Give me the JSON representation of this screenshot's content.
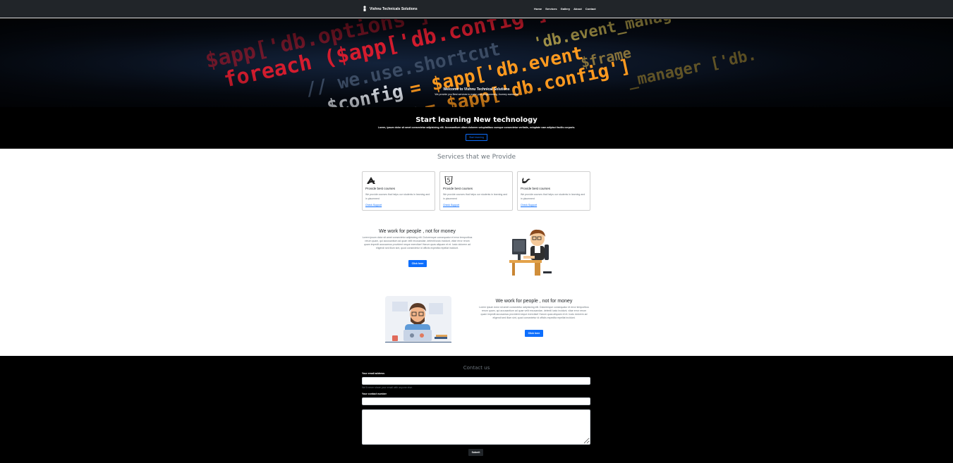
{
  "navbar": {
    "brand": "Vishnu Technicals Solutions",
    "links": [
      "Home",
      "Services",
      "Gallery",
      "About",
      "Contact"
    ]
  },
  "hero": {
    "title": "Welcome to Vishnu Technical Solutions",
    "subtitle": "We provide you Best services to make your programming Journey awesome"
  },
  "learn": {
    "title": "Start learning New technology",
    "text": "Lorem, ipsum dolor sit amet consectetur adipisicing elit. Accusantium ullam dolorem voluptatibus cumque consectetur veritatis, voluptate nam adipisci facilis corporis.",
    "button": "Start learning"
  },
  "services": {
    "title": "Services that we Provide",
    "cards": [
      {
        "icon": "angular-style-icon",
        "title": "Provide best courses",
        "text": "We provide courses that helps our students in learning and in placement",
        "link": "Check Support"
      },
      {
        "icon": "html5-icon",
        "title": "Provide best courses",
        "text": "We provide courses that helps our students in learning and in placement",
        "link": "Check Support"
      },
      {
        "icon": "wave-logo-icon",
        "title": "Provide best courses",
        "text": "We provide courses that helps our students in learning and in placement",
        "link": "Check Support"
      }
    ]
  },
  "features": [
    {
      "title": "We work for people , not for money",
      "text": "Lorem ipsum dolor sit amet consectetur adipisicing elit. Doloremque consequatur et error temporibus rerum quam, qui accusantium ad quae velit recusandae, deleniti iusto incidunt, vitae error rerum quam impedit accusamus provident neque exercitae! Harum quas aliquam et et. Iusto dolorem ad eligendi sed illum sint, quod consectetur id officiis expedita repellat incidunt.",
      "button": "Click here"
    },
    {
      "title": "We work for people , not for money",
      "text": "Lorem ipsum dolor sit amet consectetur adipisicing elit. Doloremque consequatur et error temporibus rerum quam, qui accusantium ad quae velit recusandae, deleniti iusto incidunt, vitae error rerum quam impedit accusamus provident neque exercitae! Harum quas aliquam et et. Iusto dolorem ad eligendi sed illum sint, quod consectetur id officiis expedita repellat incidunt.",
      "button": "Click here"
    }
  ],
  "contact": {
    "title": "Contact us",
    "email_label": "Your email address",
    "email_help": "We'll never share your email with anyone else.",
    "phone_label": "Your contact number",
    "submit": "Submit"
  },
  "colors": {
    "navbar": "#212529",
    "primary": "#0d6efd",
    "muted": "#6c757d",
    "section_dark": "#000000"
  }
}
